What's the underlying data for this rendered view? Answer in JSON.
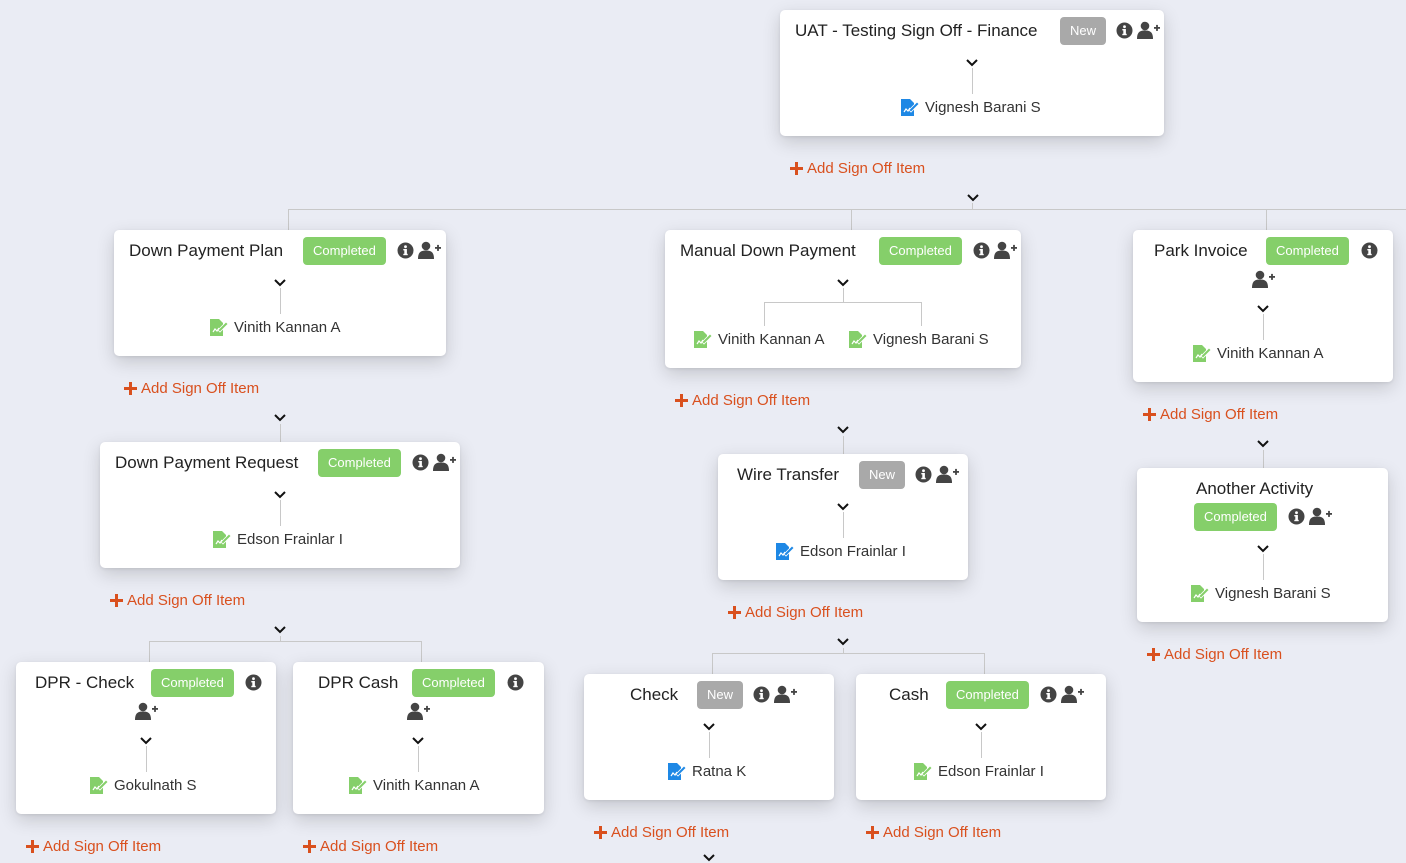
{
  "colors": {
    "background": "#eaecf4",
    "completed": "#85cf6a",
    "new": "#a9a9a9",
    "add_link": "#d9501e",
    "signer_pending": "#1e88e5",
    "signer_done": "#85cf6a"
  },
  "add_item_label": "Add Sign Off Item",
  "nodes": {
    "root": {
      "title": "UAT - Testing Sign Off - Finance",
      "status": "New",
      "approvers": [
        {
          "name": "Vignesh Barani S",
          "state": "pending"
        }
      ]
    },
    "down_payment_plan": {
      "title": "Down Payment Plan",
      "status": "Completed",
      "approvers": [
        {
          "name": "Vinith Kannan A",
          "state": "done"
        }
      ]
    },
    "manual_down_payment": {
      "title": "Manual Down Payment",
      "status": "Completed",
      "approvers": [
        {
          "name": "Vinith Kannan A",
          "state": "done"
        },
        {
          "name": "Vignesh Barani S",
          "state": "done"
        }
      ]
    },
    "park_invoice": {
      "title": "Park Invoice",
      "status": "Completed",
      "approvers": [
        {
          "name": "Vinith Kannan A",
          "state": "done"
        }
      ]
    },
    "down_payment_request": {
      "title": "Down Payment Request",
      "status": "Completed",
      "approvers": [
        {
          "name": "Edson Frainlar I",
          "state": "done"
        }
      ]
    },
    "wire_transfer": {
      "title": "Wire Transfer",
      "status": "New",
      "approvers": [
        {
          "name": "Edson Frainlar I",
          "state": "pending"
        }
      ]
    },
    "another_activity": {
      "title": "Another Activity",
      "status": "Completed",
      "approvers": [
        {
          "name": "Vignesh Barani S",
          "state": "done"
        }
      ]
    },
    "dpr_check": {
      "title": "DPR - Check",
      "status": "Completed",
      "approvers": [
        {
          "name": "Gokulnath S",
          "state": "done"
        }
      ]
    },
    "dpr_cash": {
      "title": "DPR Cash",
      "status": "Completed",
      "approvers": [
        {
          "name": "Vinith Kannan A",
          "state": "done"
        }
      ]
    },
    "check": {
      "title": "Check",
      "status": "New",
      "approvers": [
        {
          "name": "Ratna K",
          "state": "pending"
        }
      ]
    },
    "cash": {
      "title": "Cash",
      "status": "Completed",
      "approvers": [
        {
          "name": "Edson Frainlar I",
          "state": "done"
        }
      ]
    }
  }
}
